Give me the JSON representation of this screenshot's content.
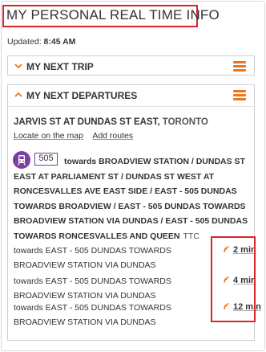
{
  "header": {
    "title": "MY PERSONAL REAL TIME INFO"
  },
  "updated": {
    "label": "Updated:",
    "time": "8:45 AM"
  },
  "next_trip": {
    "title": "MY NEXT TRIP"
  },
  "next_departures": {
    "title": "MY NEXT DEPARTURES",
    "stop": {
      "name": "JARVIS ST AT DUNDAS ST EAST,",
      "city": "TORONTO"
    },
    "links": {
      "locate": "Locate on the map",
      "add_routes": "Add routes"
    },
    "route": {
      "number": "505",
      "description": "towards BROADVIEW STATION / DUNDAS ST EAST AT PARLIAMENT ST / DUNDAS ST WEST AT RONCESVALLES AVE EAST SIDE / EAST - 505 DUNDAS TOWARDS BROADVIEW / EAST - 505 DUNDAS TOWARDS BROADVIEW STATION VIA DUNDAS / EAST - 505 DUNDAS TOWARDS RONCESVALLES AND QUEEN",
      "agency": "TTC"
    },
    "departures": [
      {
        "text": "towards EAST - 505 DUNDAS TOWARDS BROADVIEW STATION VIA DUNDAS",
        "minutes": "2 min"
      },
      {
        "text": "towards EAST - 505 DUNDAS TOWARDS BROADVIEW STATION VIA DUNDAS",
        "minutes": "4 min"
      },
      {
        "text": "towards EAST - 505 DUNDAS TOWARDS BROADVIEW STATION VIA DUNDAS",
        "minutes": "12 min"
      }
    ]
  },
  "icons": {
    "chevron": "chevron-icon",
    "menu": "hamburger-menu-icon",
    "tram": "streetcar-icon",
    "realtime": "realtime-signal-icon"
  },
  "colors": {
    "accent": "#e87722",
    "highlight": "#d9252c",
    "route": "#7b3fa0"
  }
}
